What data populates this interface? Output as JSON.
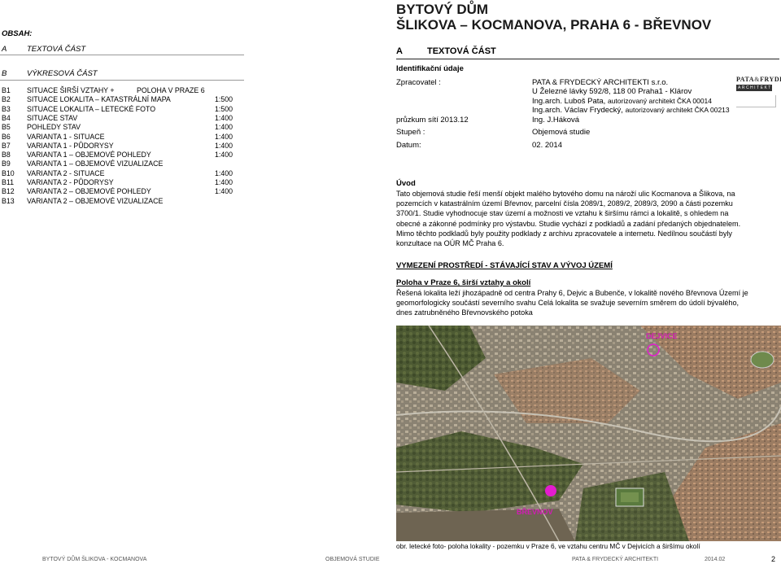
{
  "contents": {
    "heading": "OBSAH:",
    "section_a": {
      "letter": "A",
      "title": "TEXTOVÁ ČÁST"
    },
    "section_b": {
      "letter": "B",
      "title": "VÝKRESOVÁ ČÁST"
    },
    "items": [
      {
        "code": "B1",
        "title": "SITUACE ŠIRŠÍ VZTAHY +",
        "extra": "POLOHA V PRAZE 6",
        "scale": ""
      },
      {
        "code": "B2",
        "title": "SITUACE LOKALITA – KATASTRÁLNÍ MAPA",
        "extra": "",
        "scale": "1:500"
      },
      {
        "code": "B3",
        "title": "SITUACE LOKALITA – LETECKÉ FOTO",
        "extra": "",
        "scale": "1:500"
      },
      {
        "code": "B4",
        "title": "SITUACE STAV",
        "extra": "",
        "scale": "1:400"
      },
      {
        "code": "B5",
        "title": "POHLEDY STAV",
        "extra": "",
        "scale": "1:400"
      },
      {
        "code": "B6",
        "title": "VARIANTA 1 - SITUACE",
        "extra": "",
        "scale": "1:400"
      },
      {
        "code": "B7",
        "title": "VARIANTA 1 - PŮDORYSY",
        "extra": "",
        "scale": "1:400"
      },
      {
        "code": "B8",
        "title": "VARIANTA 1 – OBJEMOVÉ POHLEDY",
        "extra": "",
        "scale": "1:400"
      },
      {
        "code": "B9",
        "title": "VARIANTA 1 – OBJEMOVÉ VIZUALIZACE",
        "extra": "",
        "scale": ""
      },
      {
        "code": "B10",
        "title": "VARIANTA 2 - SITUACE",
        "extra": "",
        "scale": "1:400"
      },
      {
        "code": "B11",
        "title": "VARIANTA 2 - PŮDORYSY",
        "extra": "",
        "scale": "1:400"
      },
      {
        "code": "B12",
        "title": "VARIANTA 2 – OBJEMOVÉ POHLEDY",
        "extra": "",
        "scale": "1:400"
      },
      {
        "code": "B13",
        "title": "VARIANTA 2 – OBJEMOVÉ VIZUALIZACE",
        "extra": "",
        "scale": ""
      }
    ]
  },
  "header": {
    "title_line1": "BYTOVÝ DŮM",
    "title_line2": "ŠLIKOVA – KOCMANOVA, PRAHA 6 - BŘEVNOV",
    "section_letter": "A",
    "section_title": "TEXTOVÁ ČÁST"
  },
  "identification": {
    "heading": "Identifikační údaje",
    "prepared_label": "Zpracovatel :",
    "company": "PATA & FRYDECKÝ ARCHITEKTI s.r.o.",
    "address": "U Železné lávky 592/8, 118 00 Praha1 - Klárov",
    "person1_name": "Ing.arch. Luboš Pata,",
    "person1_role": "autorizovaný architekt ČKA 00014",
    "person2_name": "Ing.arch. Václav Frydecký,",
    "person2_role": "autorizovaný architekt ČKA 00213",
    "survey_label": "průzkum sítí 2013.12",
    "survey_value": "Ing. J.Háková",
    "stage_label": "Stupeň :",
    "stage_value": "Objemová studie",
    "date_label": "Datum:",
    "date_value": "02. 2014"
  },
  "logo": {
    "line1": "PATA",
    "amp": "&",
    "line2": "FRYDECKÝ",
    "line3": "ARCHITEKTI"
  },
  "intro": {
    "heading": "Úvod",
    "lines": [
      "Tato objemová studie řeší menší objekt malého bytového domu na nároží ulic Kocmanova a Šlikova, na",
      "pozemcích v katastrálním území Břevnov, parcelní čísla 2089/1, 2089/2, 2089/3, 2090 a části pozemku",
      "3700/1. Studie vyhodnocuje stav území a možnosti ve vztahu k širšímu rámci a lokalitě, s ohledem na",
      "obecné a zákonné podmínky pro výstavbu. Studie vychází z podkladů a zadání předaných objednatelem.",
      "Mimo těchto podkladů byly použity podklady z archivu zpracovatele a internetu. Nedílnou součástí byly",
      "konzultace na OÚR MČ Praha 6."
    ]
  },
  "section_heading": "VYMEZENÍ PROSTŘEDÍ - STÁVAJÍCÍ STAV A VÝVOJ ÚZEMÍ",
  "location": {
    "heading": "Poloha v Praze 6, širší vztahy a okolí",
    "lines": [
      "Řešená lokalita leží jihozápadně od centra Prahy 6, Dejvic a Bubenče, v lokalitě nového Břevnova Území je",
      "geomorfologicky součástí severního svahu Celá lokalita se svažuje severním směrem do údolí bývalého,",
      "dnes zatrubněného Břevnovského potoka"
    ]
  },
  "photo": {
    "label_dejvice": "DEJVICE",
    "label_brevnov": "BŘEVNOV",
    "marker_color": "#e31ccf",
    "caption": "obr. letecké foto- poloha lokality - pozemku v  Praze 6, ve vztahu centru MČ v Dejvicích a širšímu okolí"
  },
  "footer": {
    "project": "BYTOVÝ DŮM ŠLIKOVA - KOCMANOVA",
    "stage": "OBJEMOVÁ STUDIE",
    "office": "PATA & FRYDECKÝ ARCHITEKTI",
    "date": "2014.02",
    "page": "2"
  }
}
